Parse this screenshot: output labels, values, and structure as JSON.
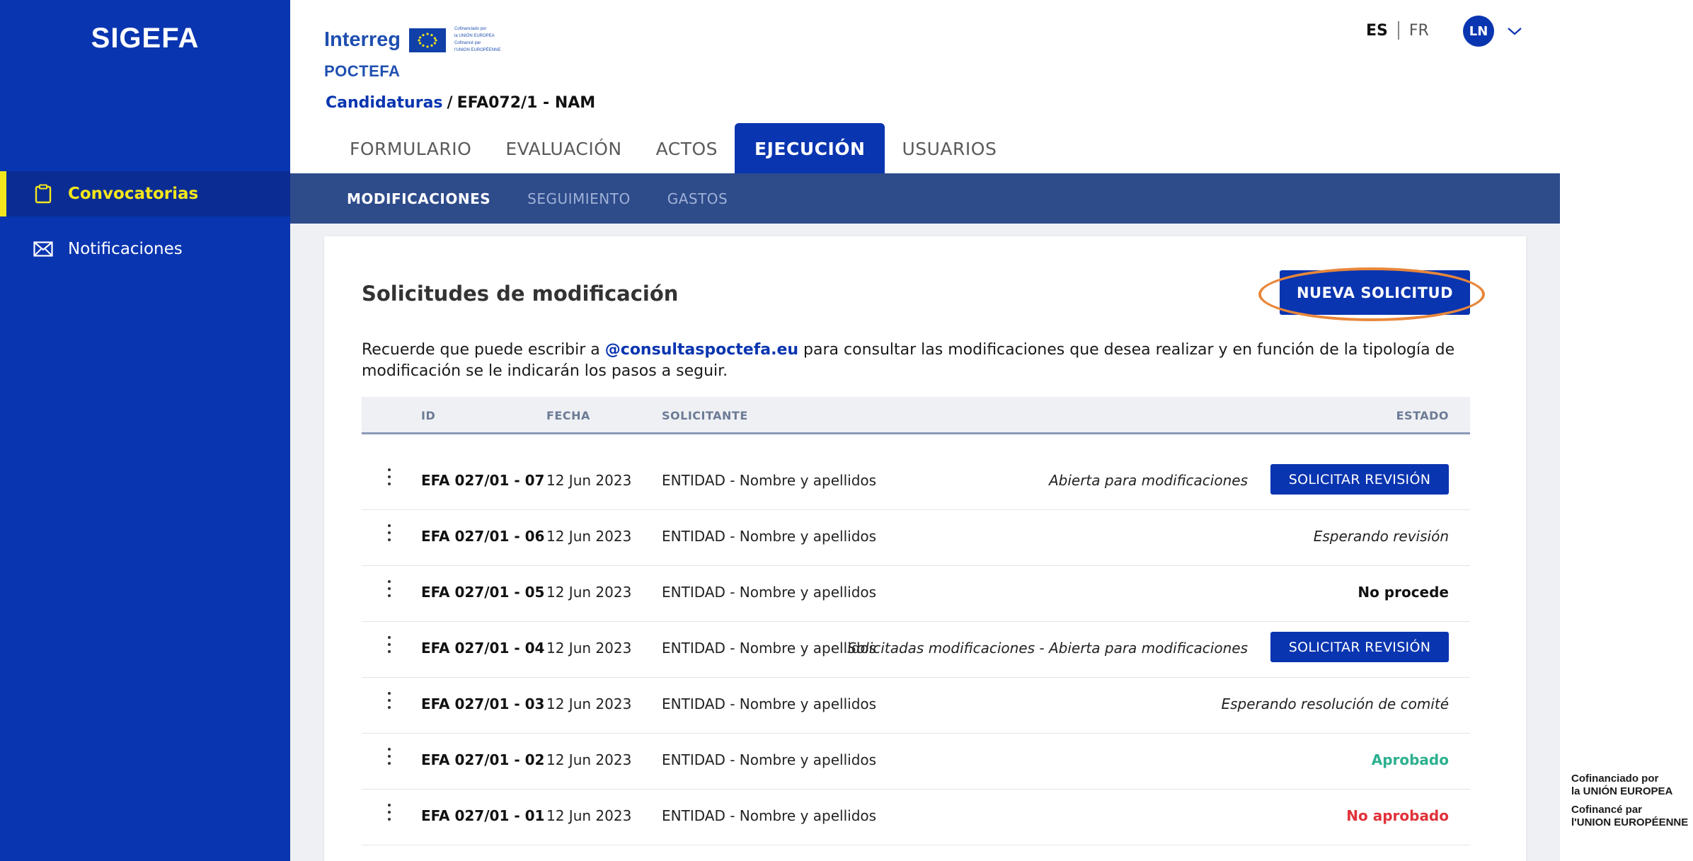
{
  "sidebar": {
    "brand": "SIGEFA",
    "items": [
      {
        "label": "Convocatorias",
        "icon": "clipboard-icon"
      },
      {
        "label": "Notificaciones",
        "icon": "envelope-icon"
      }
    ]
  },
  "header": {
    "logo_word": "Interreg",
    "logo_program": "POCTEFA",
    "eu_caption": [
      "Cofinanciado por",
      "la UNIÓN EUROPEA",
      "Cofinancé par",
      "l'UNION EUROPÉENNE"
    ],
    "breadcrumb": {
      "link": "Candidaturas",
      "separator": "/",
      "current": "EFA072/1 - NAM"
    },
    "lang_es": "ES",
    "lang_fr": "FR",
    "avatar": "LN"
  },
  "tabs": [
    "FORMULARIO",
    "EVALUACIÓN",
    "ACTOS",
    "EJECUCIÓN",
    "USUARIOS"
  ],
  "subtabs": [
    "MODIFICACIONES",
    "SEGUIMIENTO",
    "GASTOS"
  ],
  "main": {
    "title": "Solicitudes de modificación",
    "new_button": "NUEVA SOLICITUD",
    "info_before": "Recuerde que puede escribir a ",
    "info_email": "@consultaspoctefa.eu",
    "info_after": " para consultar las modificaciones que desea realizar y en función de la tipología de modificación se le indicarán los pasos a seguir."
  },
  "table": {
    "columns": [
      "ID",
      "FECHA",
      "SOLICITANTE",
      "ESTADO"
    ],
    "rows": [
      {
        "id": "EFA 027/01 - 07",
        "fecha": "12 Jun 2023",
        "solicitante": "ENTIDAD - Nombre y apellidos",
        "estado": "Abierta para modificaciones",
        "style": "italic",
        "action": "SOLICITAR REVISIÓN"
      },
      {
        "id": "EFA 027/01 - 06",
        "fecha": "12 Jun 2023",
        "solicitante": "ENTIDAD - Nombre y apellidos",
        "estado": "Esperando revisión",
        "style": "italic",
        "action": ""
      },
      {
        "id": "EFA 027/01 - 05",
        "fecha": "12 Jun 2023",
        "solicitante": "ENTIDAD - Nombre y apellidos",
        "estado": "No procede",
        "style": "bold",
        "action": ""
      },
      {
        "id": "EFA 027/01 - 04",
        "fecha": "12 Jun 2023",
        "solicitante": "ENTIDAD - Nombre y apellidos",
        "estado": "Solicitadas modificaciones - Abierta para modificaciones",
        "style": "italic",
        "action": "SOLICITAR REVISIÓN"
      },
      {
        "id": "EFA 027/01 - 03",
        "fecha": "12 Jun 2023",
        "solicitante": "ENTIDAD - Nombre y apellidos",
        "estado": "Esperando resolución de comité",
        "style": "italic",
        "action": ""
      },
      {
        "id": "EFA 027/01 - 02",
        "fecha": "12 Jun 2023",
        "solicitante": "ENTIDAD - Nombre y apellidos",
        "estado": "Aprobado",
        "style": "green",
        "action": ""
      },
      {
        "id": "EFA 027/01 - 01",
        "fecha": "12 Jun 2023",
        "solicitante": "ENTIDAD - Nombre y apellidos",
        "estado": "No aprobado",
        "style": "red",
        "action": ""
      }
    ]
  },
  "footer": {
    "cofin_es_1": "Cofinanciado por",
    "cofin_es_2": "la UNIÓN EUROPEA",
    "cofin_fr_1": "Cofinancé par",
    "cofin_fr_2": "l'UNION EUROPÉENNE"
  },
  "colors": {
    "primary": "#0a35b0",
    "sidebar_active": "#0b2d93",
    "active_accent": "#f4e61c",
    "subnav": "#2e4b8a",
    "highlight": "#e8873a",
    "approved": "#2db08f",
    "rejected": "#e0323a"
  }
}
